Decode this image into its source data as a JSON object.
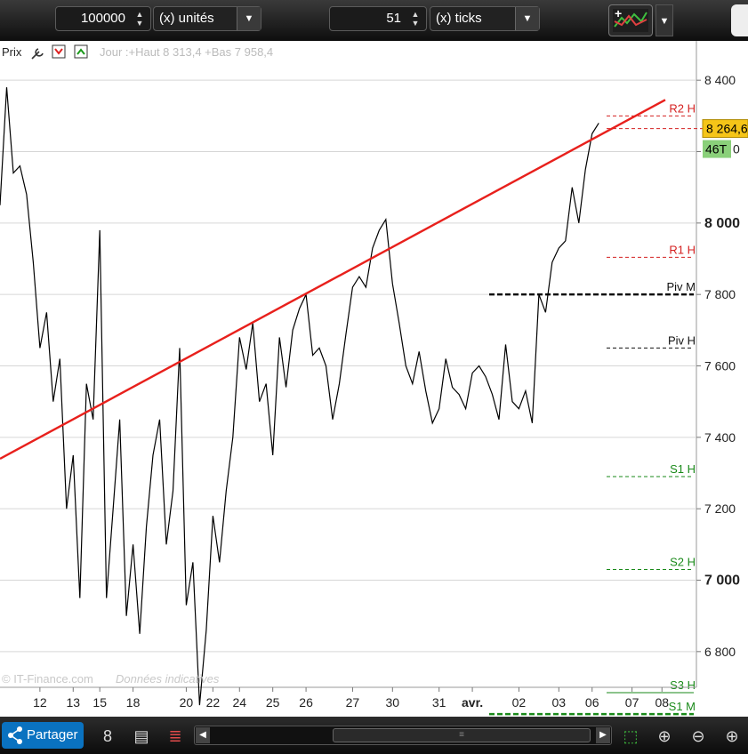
{
  "toolbar": {
    "quantity_value": "100000",
    "quantity_unit": "(x) unités",
    "ticks_value": "51",
    "ticks_unit": "(x) ticks"
  },
  "chart_header": {
    "price_label": "Prix",
    "daily_info": "Jour :+Haut 8 313,4 +Bas 7 958,4"
  },
  "watermark": {
    "source": "© IT-Finance.com",
    "note": "Données indicatives"
  },
  "bottombar": {
    "share_label": "Partager"
  },
  "colors": {
    "trendline": "#e8201c",
    "resistance": "#d42020",
    "pivot": "#111111",
    "support": "#1a8a1a",
    "current_badge": "#f5c518",
    "tick_badge": "#8ad07a"
  },
  "chart_data": {
    "type": "line",
    "ylim": [
      6700,
      8510
    ],
    "yticks": [
      6800,
      7000,
      7200,
      7400,
      7600,
      7800,
      8000,
      8200,
      8400
    ],
    "ytick_labels": [
      "6 800",
      "7 000",
      "7 200",
      "7 400",
      "7 600",
      "7 800",
      "8 000",
      "",
      "8 400"
    ],
    "bold_ticks": [
      7000,
      8000
    ],
    "xtick_labels": [
      "12",
      "13",
      "15",
      "18",
      "20",
      "22",
      "24",
      "25",
      "26",
      "27",
      "30",
      "31",
      "avr.",
      "02",
      "03",
      "06",
      "07",
      "08"
    ],
    "xtick_positions": [
      0.06,
      0.11,
      0.15,
      0.2,
      0.28,
      0.32,
      0.36,
      0.41,
      0.46,
      0.53,
      0.59,
      0.66,
      0.71,
      0.78,
      0.84,
      0.89,
      0.95,
      0.995
    ],
    "current_price": "8 264,6",
    "current_price_value": 8264.6,
    "tick_count_label": "46T",
    "tick_count_suffix": "0",
    "pivot_labels": [
      {
        "label": "R2 H",
        "value": 8300,
        "style": "resistance"
      },
      {
        "label": "R1 H",
        "value": 7904,
        "style": "resistance"
      },
      {
        "label": "Piv M",
        "value": 7800,
        "style": "pivot"
      },
      {
        "label": "Piv H",
        "value": 7650,
        "style": "pivot"
      },
      {
        "label": "S1 H",
        "value": 7290,
        "style": "support"
      },
      {
        "label": "S2 H",
        "value": 7030,
        "style": "support"
      },
      {
        "label": "S3 H",
        "value": 6685,
        "style": "support"
      },
      {
        "label": "S1 M",
        "value": 6625,
        "style": "support"
      }
    ],
    "trendline": {
      "start": [
        0.0,
        7340
      ],
      "end": [
        1.0,
        8345
      ]
    },
    "price": {
      "x": [
        0.0,
        0.01,
        0.02,
        0.03,
        0.04,
        0.05,
        0.06,
        0.07,
        0.08,
        0.09,
        0.1,
        0.11,
        0.12,
        0.13,
        0.14,
        0.15,
        0.16,
        0.17,
        0.18,
        0.19,
        0.2,
        0.21,
        0.22,
        0.23,
        0.24,
        0.25,
        0.26,
        0.27,
        0.28,
        0.29,
        0.3,
        0.31,
        0.32,
        0.33,
        0.34,
        0.35,
        0.36,
        0.37,
        0.38,
        0.39,
        0.4,
        0.41,
        0.42,
        0.43,
        0.44,
        0.45,
        0.46,
        0.47,
        0.48,
        0.49,
        0.5,
        0.51,
        0.52,
        0.53,
        0.54,
        0.55,
        0.56,
        0.57,
        0.58,
        0.59,
        0.6,
        0.61,
        0.62,
        0.63,
        0.64,
        0.65,
        0.66,
        0.67,
        0.68,
        0.69,
        0.7,
        0.71,
        0.72,
        0.73,
        0.74,
        0.75,
        0.76,
        0.77,
        0.78,
        0.79,
        0.8,
        0.81,
        0.82,
        0.83,
        0.84,
        0.85,
        0.86,
        0.87,
        0.88,
        0.89,
        0.9,
        0.91,
        0.92,
        0.93,
        0.94,
        0.95
      ],
      "y": [
        8050,
        8380,
        8140,
        8160,
        8080,
        7890,
        7650,
        7750,
        7500,
        7620,
        7200,
        7350,
        6950,
        7550,
        7450,
        7980,
        6950,
        7200,
        7450,
        6900,
        7100,
        6850,
        7150,
        7350,
        7450,
        7100,
        7250,
        7650,
        6930,
        7050,
        6650,
        6860,
        7180,
        7050,
        7250,
        7400,
        7680,
        7590,
        7720,
        7500,
        7550,
        7350,
        7680,
        7540,
        7700,
        7760,
        7800,
        7630,
        7650,
        7600,
        7450,
        7550,
        7690,
        7820,
        7850,
        7820,
        7930,
        7980,
        8010,
        7830,
        7720,
        7600,
        7550,
        7640,
        7530,
        7440,
        7480,
        7620,
        7540,
        7520,
        7480,
        7580,
        7600,
        7570,
        7520,
        7450,
        7660,
        7500,
        7480,
        7530,
        7440,
        7800,
        7750,
        7890,
        7930,
        7950,
        8100,
        8000,
        8150,
        8250,
        8280
      ]
    }
  }
}
